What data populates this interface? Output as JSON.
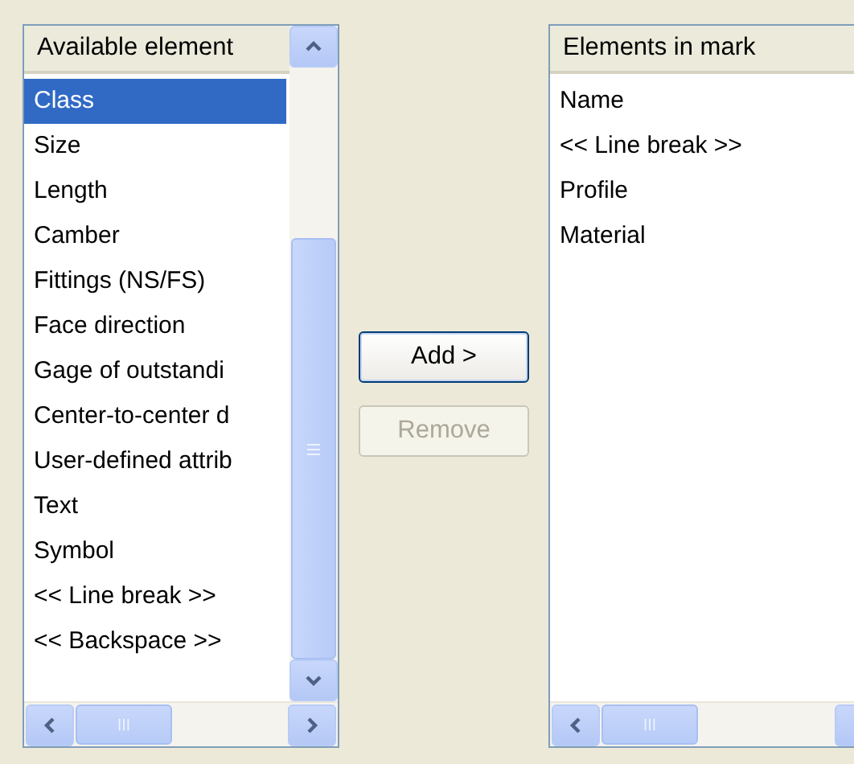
{
  "available_list": {
    "header": "Available element",
    "items": [
      {
        "label": "Class",
        "selected": true
      },
      {
        "label": "Size",
        "selected": false
      },
      {
        "label": "Length",
        "selected": false
      },
      {
        "label": "Camber",
        "selected": false
      },
      {
        "label": "Fittings (NS/FS)",
        "selected": false
      },
      {
        "label": "Face direction",
        "selected": false
      },
      {
        "label": "Gage of outstandi",
        "selected": false
      },
      {
        "label": "Center-to-center d",
        "selected": false
      },
      {
        "label": "User-defined attrib",
        "selected": false
      },
      {
        "label": "Text",
        "selected": false
      },
      {
        "label": "Symbol",
        "selected": false
      },
      {
        "label": "<< Line break >>",
        "selected": false
      },
      {
        "label": "<< Backspace >>",
        "selected": false
      }
    ]
  },
  "buttons": [
    {
      "label": "Add >",
      "disabled": false
    },
    {
      "label": "Remove",
      "disabled": true
    }
  ],
  "mark_list": {
    "header": "Elements in mark",
    "items": [
      {
        "label": "Name",
        "selected": false
      },
      {
        "label": "<< Line break >>",
        "selected": false
      },
      {
        "label": "Profile",
        "selected": false
      },
      {
        "label": "Material",
        "selected": false
      }
    ]
  }
}
